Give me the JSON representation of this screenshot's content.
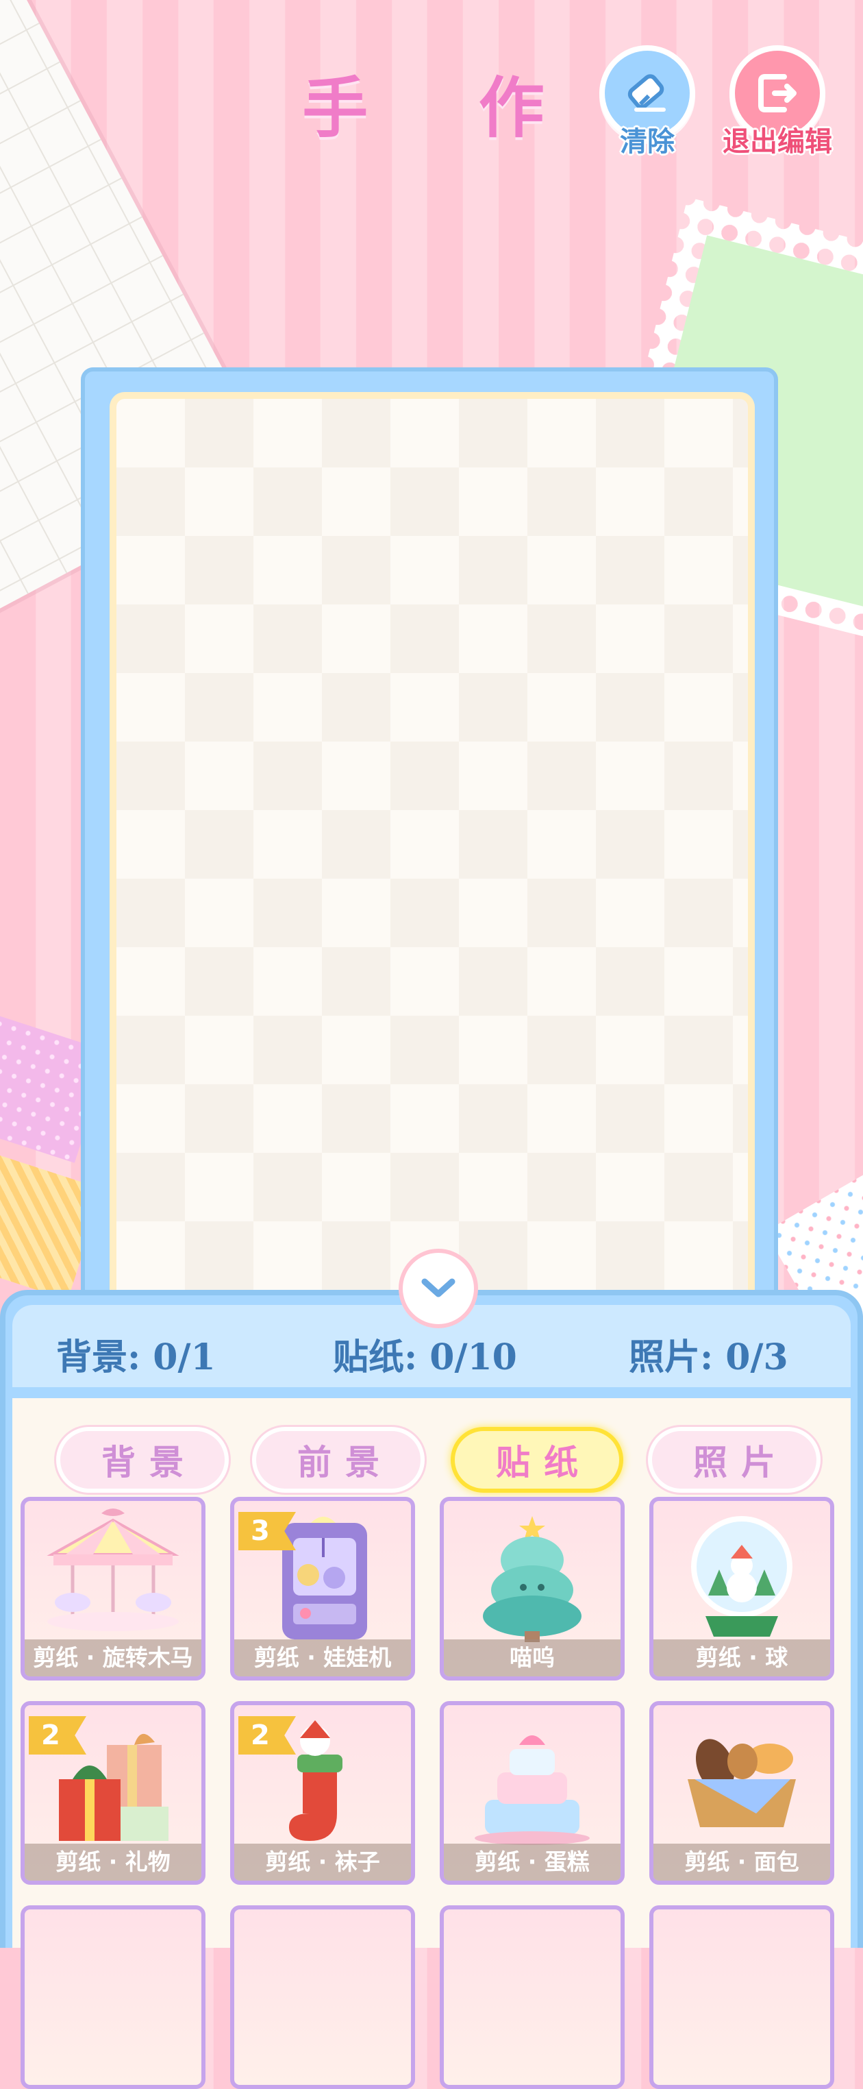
{
  "header": {
    "title": "手 作",
    "clear_label": "清除",
    "exit_label": "退出编辑"
  },
  "counts": {
    "background": "背景: 0/1",
    "stickers": "贴纸: 0/10",
    "photos": "照片: 0/3"
  },
  "tabs": [
    {
      "label": "背景",
      "active": false
    },
    {
      "label": "前景",
      "active": false
    },
    {
      "label": "贴纸",
      "active": true
    },
    {
      "label": "照片",
      "active": false
    }
  ],
  "items": [
    {
      "name": "剪纸 · 旋转木马",
      "icon": "carousel-icon"
    },
    {
      "name": "剪纸 · 娃娃机",
      "badge": "3",
      "icon": "claw-machine-icon"
    },
    {
      "name": "喵呜",
      "icon": "cat-tree-icon"
    },
    {
      "name": "剪纸 · 球",
      "icon": "snow-globe-icon"
    },
    {
      "name": "剪纸 · 礼物",
      "badge": "2",
      "icon": "gift-icon"
    },
    {
      "name": "剪纸 · 袜子",
      "badge": "2",
      "icon": "stocking-icon"
    },
    {
      "name": "剪纸 · 蛋糕",
      "icon": "cake-icon"
    },
    {
      "name": "剪纸 · 面包",
      "icon": "bread-basket-icon"
    }
  ],
  "colors": {
    "accent_pink": "#f07cc8",
    "panel_blue": "#a7d7ff",
    "count_text": "#3d78b4",
    "badge_yellow": "#f6c23e",
    "active_tab": "#ffe237"
  }
}
